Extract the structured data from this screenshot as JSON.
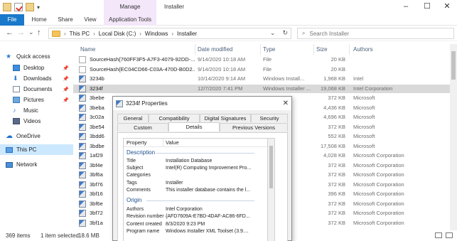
{
  "window": {
    "title": "Installer",
    "manage_tab": "Manage",
    "minimize": "–",
    "maximize": "☐",
    "close": "✕"
  },
  "ribbon": {
    "tabs": [
      "File",
      "Home",
      "Share",
      "View",
      "Application Tools"
    ],
    "qat_dropdown": "▾"
  },
  "address": {
    "crumbs": [
      "This PC",
      "Local Disk (C:)",
      "Windows",
      "Installer"
    ],
    "back": "←",
    "forward": "→",
    "dropdown": "⌄",
    "up": "↑",
    "addr_dropdown": "⌄",
    "refresh": "↻"
  },
  "search": {
    "placeholder": "Search Installer",
    "icon": "⌕"
  },
  "sidebar": {
    "items": [
      {
        "label": "Quick access",
        "icon": "star-icon"
      },
      {
        "label": "Desktop",
        "icon": "desktop-icon"
      },
      {
        "label": "Downloads",
        "icon": "download-icon"
      },
      {
        "label": "Documents",
        "icon": "documents-icon"
      },
      {
        "label": "Pictures",
        "icon": "pictures-icon"
      },
      {
        "label": "Music",
        "icon": "music-icon"
      },
      {
        "label": "Videos",
        "icon": "videos-icon"
      },
      {
        "label": "OneDrive",
        "icon": "onedrive-icon"
      },
      {
        "label": "This PC",
        "icon": "pc-icon"
      },
      {
        "label": "Network",
        "icon": "network-icon"
      }
    ],
    "pin": "📌"
  },
  "columns": {
    "name": "Name",
    "date": "Date modified",
    "type": "Type",
    "size": "Size",
    "authors": "Authors"
  },
  "files": [
    {
      "name": "SourceHash{760FF3F5-A7F3-4079-92DD-...",
      "date": "9/14/2020 10:18 AM",
      "type": "File",
      "size": "20 KB",
      "authors": "",
      "icon": "doc"
    },
    {
      "name": "SourceHash{EC04CD66-C03A-470D-B0D2...",
      "date": "9/14/2020 10:18 AM",
      "type": "File",
      "size": "20 KB",
      "authors": "",
      "icon": "doc"
    },
    {
      "name": "3234b",
      "date": "10/14/2020 9:14 AM",
      "type": "Windows Install...",
      "size": "1,968 KB",
      "authors": "Intel",
      "icon": "msi"
    },
    {
      "name": "3234f",
      "date": "12/7/2020 7:41 PM",
      "type": "Windows Installer ...",
      "size": "19,068 KB",
      "authors": "Intel Corporation",
      "icon": "msi"
    },
    {
      "name": "3bebe",
      "date": "",
      "type": "",
      "size": "372 KB",
      "authors": "Microsoft",
      "icon": "msi"
    },
    {
      "name": "3beba",
      "date": "",
      "type": "",
      "size": "4,436 KB",
      "authors": "Microsoft",
      "icon": "msi"
    },
    {
      "name": "3c02a",
      "date": "",
      "type": "",
      "size": "4,696 KB",
      "authors": "Microsoft",
      "icon": "msi"
    },
    {
      "name": "3be54",
      "date": "",
      "type": "",
      "size": "372 KB",
      "authors": "Microsoft",
      "icon": "msi"
    },
    {
      "name": "3bdd6",
      "date": "",
      "type": "",
      "size": "552 KB",
      "authors": "Microsoft",
      "icon": "msi"
    },
    {
      "name": "3bdbe",
      "date": "",
      "type": "",
      "size": "17,508 KB",
      "authors": "Microsoft",
      "icon": "msi"
    },
    {
      "name": "1af29",
      "date": "",
      "type": "",
      "size": "4,028 KB",
      "authors": "Microsoft Corporation",
      "icon": "msi"
    },
    {
      "name": "3bf4e",
      "date": "",
      "type": "",
      "size": "372 KB",
      "authors": "Microsoft Corporation",
      "icon": "msi"
    },
    {
      "name": "3bf6a",
      "date": "",
      "type": "",
      "size": "372 KB",
      "authors": "Microsoft Corporation",
      "icon": "msi"
    },
    {
      "name": "3bf76",
      "date": "",
      "type": "",
      "size": "372 KB",
      "authors": "Microsoft Corporation",
      "icon": "msi"
    },
    {
      "name": "3bf16",
      "date": "",
      "type": "",
      "size": "396 KB",
      "authors": "Microsoft Corporation",
      "icon": "msi"
    },
    {
      "name": "3bf6e",
      "date": "",
      "type": "",
      "size": "372 KB",
      "authors": "Microsoft Corporation",
      "icon": "msi"
    },
    {
      "name": "3bf72",
      "date": "",
      "type": "",
      "size": "372 KB",
      "authors": "Microsoft Corporation",
      "icon": "msi"
    },
    {
      "name": "3bf1a",
      "date": "",
      "type": "",
      "size": "372 KB",
      "authors": "Microsoft Corporation",
      "icon": "msi"
    }
  ],
  "status": {
    "items": "369 items",
    "selected": "1 item selected",
    "size": "18.6 MB"
  },
  "dialog": {
    "title": "3234f Properties",
    "close": "✕",
    "tabs_row1": [
      "General",
      "Compatibility",
      "Digital Signatures",
      "Security"
    ],
    "tabs_row2": [
      "Custom",
      "Details",
      "Previous Versions"
    ],
    "active_tab": "Details",
    "col_property": "Property",
    "col_value": "Value",
    "sections": [
      {
        "title": "Description",
        "rows": [
          {
            "k": "Title",
            "v": "Installation Database"
          },
          {
            "k": "Subject",
            "v": "Intel(R) Computing Improvement Pro..."
          },
          {
            "k": "Categories",
            "v": ""
          },
          {
            "k": "Tags",
            "v": "Installer"
          },
          {
            "k": "Comments",
            "v": "This installer database contains the l..."
          }
        ]
      },
      {
        "title": "Origin",
        "rows": [
          {
            "k": "Authors",
            "v": "Intel Corporation"
          },
          {
            "k": "Revision number",
            "v": "{AFD7609A-E7BD-4DAF-AC86-6FD..."
          },
          {
            "k": "Content created",
            "v": "8/3/2020 9:23 PM"
          },
          {
            "k": "Program name",
            "v": "Windows Installer XML Toolset (3.9...."
          }
        ]
      }
    ]
  }
}
